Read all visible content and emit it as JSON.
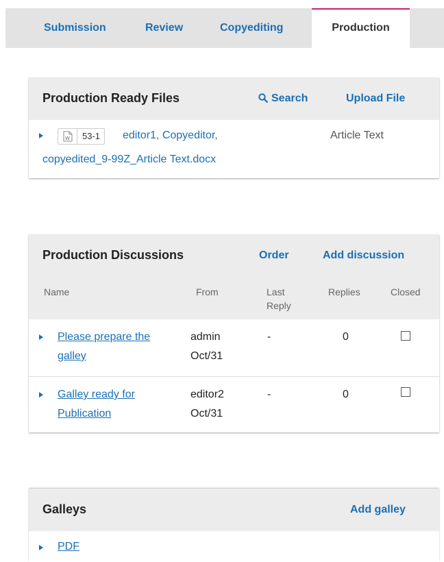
{
  "tabs": [
    {
      "label": "Submission"
    },
    {
      "label": "Review"
    },
    {
      "label": "Copyediting"
    },
    {
      "label": "Production"
    }
  ],
  "ready_files": {
    "title": "Production Ready Files",
    "search_label": "Search",
    "upload_label": "Upload File",
    "file": {
      "id": "53-1",
      "name_line1": "editor1, Copyeditor,",
      "name_line2": "copyedited_9-99Z_Article Text.docx",
      "component": "Article Text"
    }
  },
  "discussions": {
    "title": "Production Discussions",
    "order_label": "Order",
    "add_label": "Add discussion",
    "columns": {
      "name": "Name",
      "from": "From",
      "last_reply_1": "Last",
      "last_reply_2": "Reply",
      "replies": "Replies",
      "closed": "Closed"
    },
    "rows": [
      {
        "name_1": "Please prepare the",
        "name_2": "galley",
        "from_1": "admin",
        "from_2": "Oct/31",
        "last_reply": "-",
        "replies": "0"
      },
      {
        "name_1": "Galley ready for",
        "name_2": "Publication",
        "from_1": "editor2",
        "from_2": "Oct/31",
        "last_reply": "-",
        "replies": "0"
      }
    ]
  },
  "galleys": {
    "title": "Galleys",
    "add_label": "Add galley",
    "items": [
      {
        "label": "PDF"
      }
    ]
  },
  "colors": {
    "link": "#1a6fb5",
    "active_tab_border": "#c51f73",
    "tab_bg": "#e3e3e3",
    "panel_head_bg": "#ececec"
  }
}
